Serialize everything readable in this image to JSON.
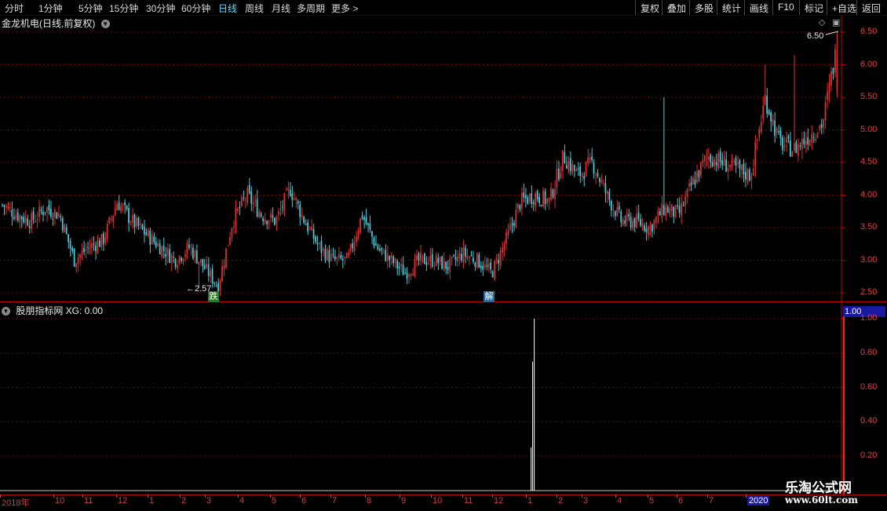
{
  "toolbar": {
    "periods": [
      "分时",
      "1分钟",
      "5分钟",
      "15分钟",
      "30分钟",
      "60分钟",
      "日线",
      "周线",
      "月线",
      "多周期",
      "更多 >"
    ],
    "active_period": "日线",
    "right_buttons": [
      "复权",
      "叠加",
      "多股",
      "统计",
      "画线",
      "F10",
      "标记",
      "+自选",
      "返回"
    ]
  },
  "main": {
    "title": "金龙机电(日线,前复权)",
    "y_ticks": [
      "6.50",
      "6.00",
      "5.50",
      "5.00",
      "4.50",
      "4.00",
      "3.50",
      "3.00",
      "2.50"
    ],
    "high_label": "6.50",
    "low_label": "2.57",
    "signals": [
      "跌",
      "解"
    ]
  },
  "indicator": {
    "title": "股朋指标网 XG: 0.00",
    "current_value": "1.00",
    "y_ticks": [
      "1.00",
      "0.80",
      "0.60",
      "0.40",
      "0.20"
    ]
  },
  "x_axis": {
    "labels": [
      "2018年",
      "10",
      "11",
      "12",
      "1",
      "2",
      "3",
      "4",
      "5",
      "6",
      "7",
      "8",
      "9",
      "10",
      "11",
      "12",
      "1",
      "2",
      "3",
      "4",
      "5",
      "6",
      "7",
      "2020"
    ]
  },
  "watermark": {
    "line1": "乐淘公式网",
    "line2": "www.60lt.com"
  },
  "colors": {
    "up": "#e03030",
    "down": "#40d0e0",
    "grid": "#7a0000",
    "axis": "#c00000"
  },
  "chart_data": {
    "type": "candlestick",
    "title": "金龙机电(日线,前复权)",
    "ylim": [
      2.4,
      6.65
    ],
    "y_ticks": [
      2.5,
      3.0,
      3.5,
      4.0,
      4.5,
      5.0,
      5.5,
      6.0,
      6.5
    ],
    "x_labels": [
      "2018年",
      "10",
      "11",
      "12",
      "1",
      "2",
      "3",
      "4",
      "5",
      "6",
      "7",
      "8",
      "9",
      "10",
      "11",
      "12",
      "1",
      "2",
      "3",
      "4",
      "5",
      "6",
      "7",
      "2020"
    ],
    "close_trend": [
      3.85,
      3.7,
      3.6,
      3.8,
      3.7,
      3.0,
      3.2,
      3.3,
      3.9,
      3.6,
      3.4,
      3.2,
      3.0,
      3.2,
      2.9,
      2.6,
      3.6,
      4.0,
      3.7,
      3.6,
      4.1,
      3.6,
      3.2,
      3.0,
      3.0,
      3.7,
      3.2,
      3.0,
      2.8,
      3.0,
      3.0,
      2.9,
      3.1,
      3.0,
      2.8,
      3.3,
      3.9,
      4.0,
      3.9,
      4.6,
      4.3,
      4.5,
      4.0,
      3.6,
      3.6,
      3.5,
      3.8,
      3.7,
      4.2,
      4.6,
      4.5,
      4.4,
      4.3,
      5.5,
      4.8,
      4.7,
      4.9,
      5.1,
      6.3
    ],
    "high_marker": 6.5,
    "low_marker": 2.57,
    "indicator": {
      "name": "XG",
      "ylim": [
        0,
        1.0
      ],
      "y_ticks": [
        0.2,
        0.4,
        0.6,
        0.8,
        1.0
      ],
      "spike_at_fraction": 0.633,
      "spike_value": 1.0
    }
  }
}
